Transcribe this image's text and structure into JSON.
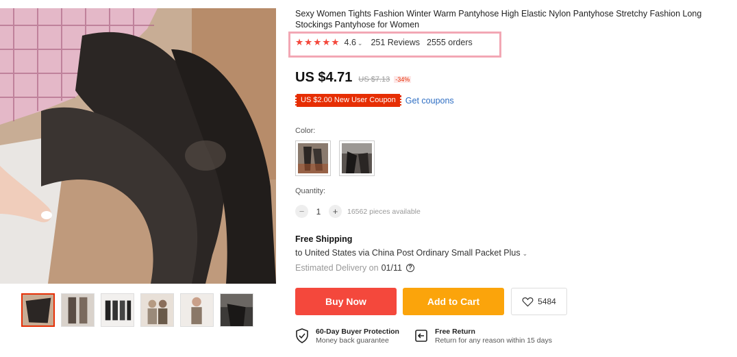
{
  "product": {
    "title": "Sexy Women Tights Fashion Winter Warm Pantyhose High Elastic Nylon Pantyhose Stretchy Fashion Long Stockings Pantyhose for Women",
    "stars": "★★★★★",
    "rating": "4.6",
    "rating_chevron": "⌄",
    "reviews": "251 Reviews",
    "orders": "2555 orders"
  },
  "pricing": {
    "price": "US $4.71",
    "old_price": "US $7.13",
    "discount": "-34%",
    "coupon": "US $2.00 New User Coupon",
    "get_coupons": "Get coupons"
  },
  "variants": {
    "color_label": "Color:",
    "swatches": [
      "swatch-1",
      "swatch-2"
    ]
  },
  "quantity": {
    "label": "Quantity:",
    "minus": "−",
    "value": "1",
    "plus": "+",
    "available": "16562 pieces available"
  },
  "shipping": {
    "title": "Free Shipping",
    "to": "to United States via China Post Ordinary Small Packet Plus",
    "chevron": "⌄",
    "estimated_label": "Estimated Delivery on",
    "estimated_date": "01/11",
    "help_icon": "?"
  },
  "actions": {
    "buy_now": "Buy Now",
    "add_to_cart": "Add to Cart",
    "wishlist_count": "5484"
  },
  "guarantees": [
    {
      "title": "60-Day Buyer Protection",
      "subtitle": "Money back guarantee",
      "icon": "shield-check-icon"
    },
    {
      "title": "Free Return",
      "subtitle": "Return for any reason within 15 days",
      "icon": "return-icon"
    }
  ],
  "colors": {
    "accent_red": "#f4483c",
    "accent_orange": "#fba40b",
    "coupon_red": "#e62e04",
    "link_blue": "#2e6ec3",
    "highlight_pink": "#f2a7b4"
  }
}
